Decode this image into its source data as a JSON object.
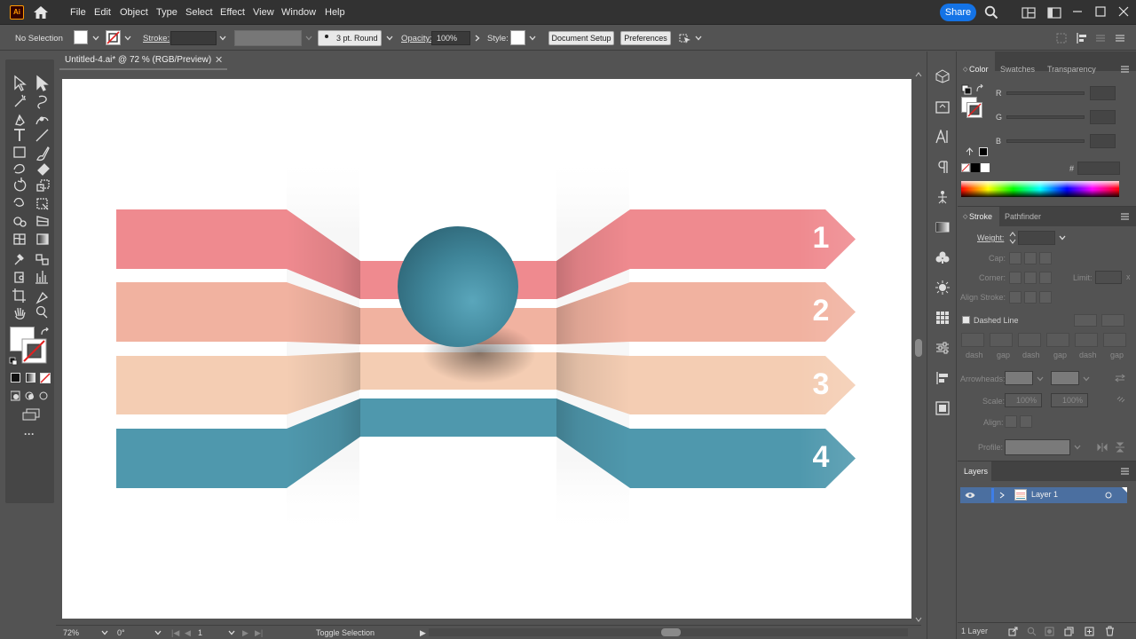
{
  "app": {
    "logo_text": "Ai",
    "menu": [
      "File",
      "Edit",
      "Object",
      "Type",
      "Select",
      "Effect",
      "View",
      "Window",
      "Help"
    ],
    "share_label": "Share"
  },
  "control_bar": {
    "selection_label": "No Selection",
    "stroke_label": "Stroke:",
    "brush_value": "3 pt. Round",
    "opacity_label": "Opacity:",
    "opacity_value": "100%",
    "style_label": "Style:",
    "document_setup_label": "Document Setup",
    "preferences_label": "Preferences"
  },
  "document": {
    "tab_title": "Untitled-4.ai* @ 72 % (RGB/Preview)",
    "close_glyph": "✕"
  },
  "artwork": {
    "colors": {
      "row1": "#ef8a8f",
      "row2": "#f1b2a0",
      "row3": "#f4cdb3",
      "row4": "#4f98ad",
      "sphere": "#4a8fa3"
    },
    "numbers": [
      "1",
      "2",
      "3",
      "4"
    ]
  },
  "status_bar": {
    "zoom": "72%",
    "rotation": "0°",
    "artboard_number": "1",
    "status_text": "Toggle Selection"
  },
  "color_panel": {
    "tabs": [
      "Color",
      "Swatches",
      "Transparency"
    ],
    "channels": [
      "R",
      "G",
      "B"
    ],
    "hex_label": "#"
  },
  "stroke_panel": {
    "tabs": [
      "Stroke",
      "Pathfinder"
    ],
    "weight_label": "Weight:",
    "cap_label": "Cap:",
    "corner_label": "Corner:",
    "limit_label": "Limit:",
    "align_label": "Align Stroke:",
    "dashed_label": "Dashed Line",
    "dash_labels": [
      "dash",
      "gap",
      "dash",
      "gap",
      "dash",
      "gap"
    ],
    "arrowheads_label": "Arrowheads:",
    "scale_label": "Scale:",
    "scale_values": [
      "100%",
      "100%"
    ],
    "align2_label": "Align:",
    "profile_label": "Profile:"
  },
  "layers_panel": {
    "tab": "Layers",
    "layer_name": "Layer 1",
    "footer_count": "1 Layer"
  }
}
